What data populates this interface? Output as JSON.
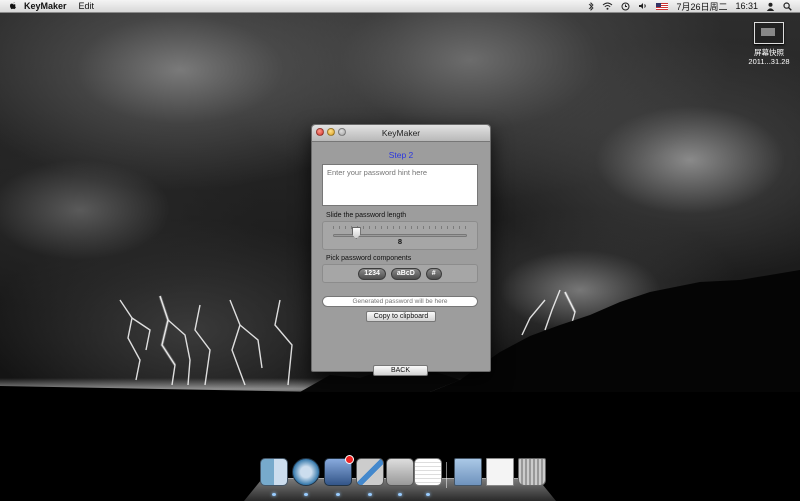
{
  "menubar": {
    "app_name": "KeyMaker",
    "menus": [
      "Edit"
    ],
    "date": "7月26日周二",
    "time": "16:31",
    "status_icons": [
      "bluetooth-icon",
      "wifi-icon",
      "time-machine-icon",
      "volume-icon",
      "flag-icon",
      "user-icon",
      "spotlight-icon"
    ]
  },
  "desktop_icon": {
    "label_line1": "屏幕快照",
    "label_line2": "2011...31.28"
  },
  "window": {
    "title": "KeyMaker",
    "step_label": "Step 2",
    "hint_placeholder": "Enter your password hint here",
    "length_label": "Slide the password length",
    "length_value": "8",
    "length_fraction": 0.15,
    "components_label": "Pick password components",
    "components": [
      "1234",
      "aBcD",
      "#"
    ],
    "generated_placeholder": "Generated password will be here",
    "copy_button": "Copy to clipboard",
    "back_button": "BACK"
  },
  "dock": {
    "items": [
      "finder",
      "safari",
      "mail",
      "xcode",
      "preview",
      "textedit",
      "separator",
      "folder",
      "documents",
      "trash"
    ]
  },
  "colors": {
    "step_label": "#2a36e0",
    "window_bg": "#9d9d9d"
  }
}
